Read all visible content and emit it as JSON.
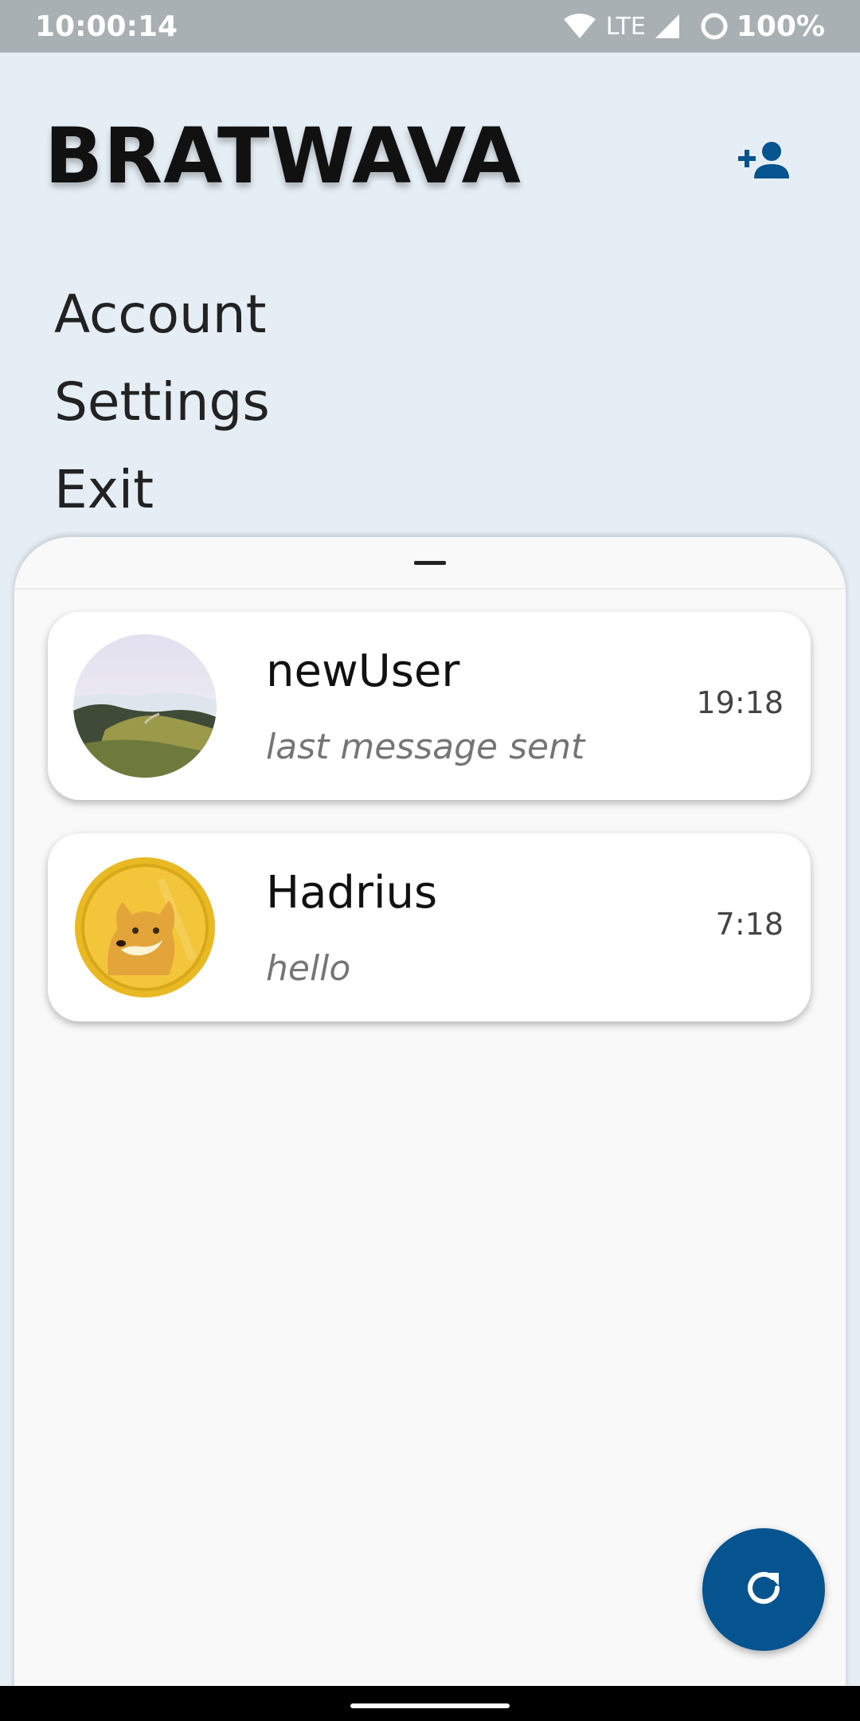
{
  "status_bar": {
    "time": "10:00:14",
    "network": "LTE",
    "battery": "100%",
    "icons": [
      "wifi-icon",
      "signal-icon",
      "battery-icon"
    ]
  },
  "header": {
    "title": "BRATWAVA",
    "add_user_icon": "add-person-icon",
    "accent_color": "#06548f"
  },
  "menu": {
    "items": [
      {
        "label": "Account"
      },
      {
        "label": "Settings"
      },
      {
        "label": "Exit"
      }
    ]
  },
  "chats": [
    {
      "name": "newUser",
      "last_message": "last message sent",
      "time": "19:18",
      "avatar": "landscape-photo"
    },
    {
      "name": "Hadrius",
      "last_message": "hello",
      "time": "7:18",
      "avatar": "doge-coin-image"
    }
  ],
  "fab": {
    "icon": "refresh-icon"
  }
}
